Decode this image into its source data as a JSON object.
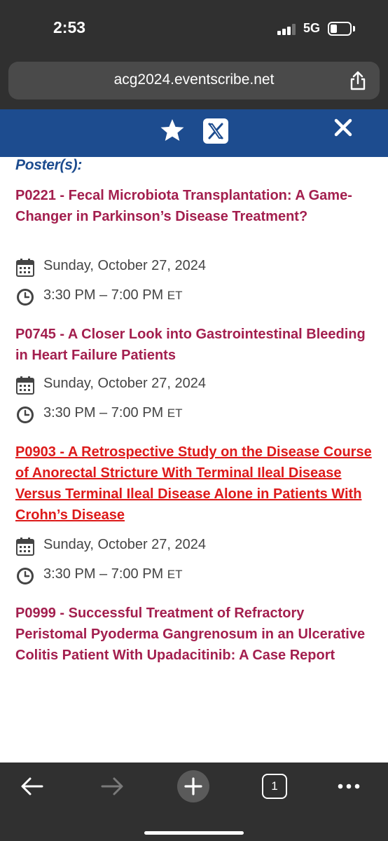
{
  "status_bar": {
    "time": "2:53",
    "network": "5G"
  },
  "browser": {
    "url": "acg2024.eventscribe.net"
  },
  "site_header": {
    "icons": [
      "star-icon",
      "x-logo-icon",
      "close-icon"
    ],
    "background": "#1d4c8f"
  },
  "section": {
    "heading": "Poster(s):"
  },
  "posters": [
    {
      "title": "P0221 - Fecal Microbiota Transplantation: A Game-Changer in Parkinson’s Disease Treatment?",
      "date": "Sunday, October 27, 2024",
      "time": "3:30 PM – 7:00 PM",
      "tz": "ET"
    },
    {
      "title": "P0745 - A Closer Look into Gastrointestinal Bleeding in Heart Failure Patients",
      "date": "Sunday, October 27, 2024",
      "time": "3:30 PM – 7:00 PM",
      "tz": "ET"
    },
    {
      "title": "P0903 - A Retrospective Study on the Disease Course of Anorectal Stricture With Terminal Ileal Disease Versus Terminal Ileal Disease Alone in Patients With Crohn’s Disease",
      "date": "Sunday, October 27, 2024",
      "time": "3:30 PM – 7:00 PM",
      "tz": "ET"
    },
    {
      "title": "P0999 - Successful Treatment of Refractory Peristomal Pyoderma Gangrenosum in an Ulcerative Colitis Patient With Upadacitinib: A Case Report"
    }
  ],
  "toolbar": {
    "tab_count": "1",
    "icons": [
      "back-arrow-icon",
      "forward-arrow-icon",
      "new-tab-icon",
      "tab-switcher-icon",
      "more-icon"
    ]
  },
  "colors": {
    "poster_title": "#a31f4e",
    "active_link": "#dd1a1a",
    "heading": "#1d4c8f"
  }
}
